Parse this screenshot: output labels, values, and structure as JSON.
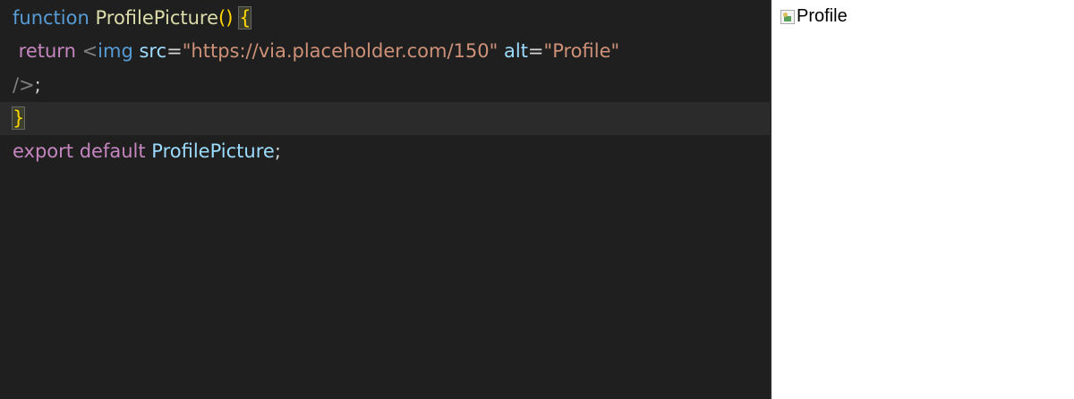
{
  "editor": {
    "lines": [
      {
        "tokens": [
          {
            "text": "function",
            "kind": "fn"
          },
          {
            "text": " ",
            "kind": "punc"
          },
          {
            "text": "ProfilePicture",
            "kind": "name"
          },
          {
            "text": "()",
            "kind": "paren"
          },
          {
            "text": " ",
            "kind": "punc"
          },
          {
            "text": "{",
            "kind": "bracehl"
          }
        ]
      },
      {
        "tokens": [
          {
            "text": " return ",
            "kind": "kw"
          },
          {
            "text": "<",
            "kind": "tag"
          },
          {
            "text": "img",
            "kind": "tagname"
          },
          {
            "text": " ",
            "kind": "punc"
          },
          {
            "text": "src",
            "kind": "attr"
          },
          {
            "text": "=",
            "kind": "punc"
          },
          {
            "text": "\"https://via.placeholder.com/150\"",
            "kind": "str"
          },
          {
            "text": " ",
            "kind": "punc"
          },
          {
            "text": "alt",
            "kind": "attr"
          },
          {
            "text": "=",
            "kind": "punc"
          },
          {
            "text": "\"Profile\"",
            "kind": "str"
          }
        ]
      },
      {
        "tokens": [
          {
            "text": "/>",
            "kind": "tag"
          },
          {
            "text": ";",
            "kind": "punc"
          }
        ]
      },
      {
        "tokens": [
          {
            "text": "}",
            "kind": "bracehl"
          }
        ]
      },
      {
        "tokens": [
          {
            "text": "export",
            "kind": "kw"
          },
          {
            "text": " ",
            "kind": "punc"
          },
          {
            "text": "default",
            "kind": "kw"
          },
          {
            "text": " ",
            "kind": "punc"
          },
          {
            "text": "ProfilePicture",
            "kind": "ident"
          },
          {
            "text": ";",
            "kind": "punc"
          }
        ]
      }
    ],
    "current_line": 4
  },
  "preview": {
    "broken_image_alt": "Profile",
    "icon": "broken-image-icon"
  },
  "colors": {
    "editor_bg": "#1f1f1f",
    "current_line_bg": "#2b2b2b",
    "preview_bg": "#ffffff"
  }
}
